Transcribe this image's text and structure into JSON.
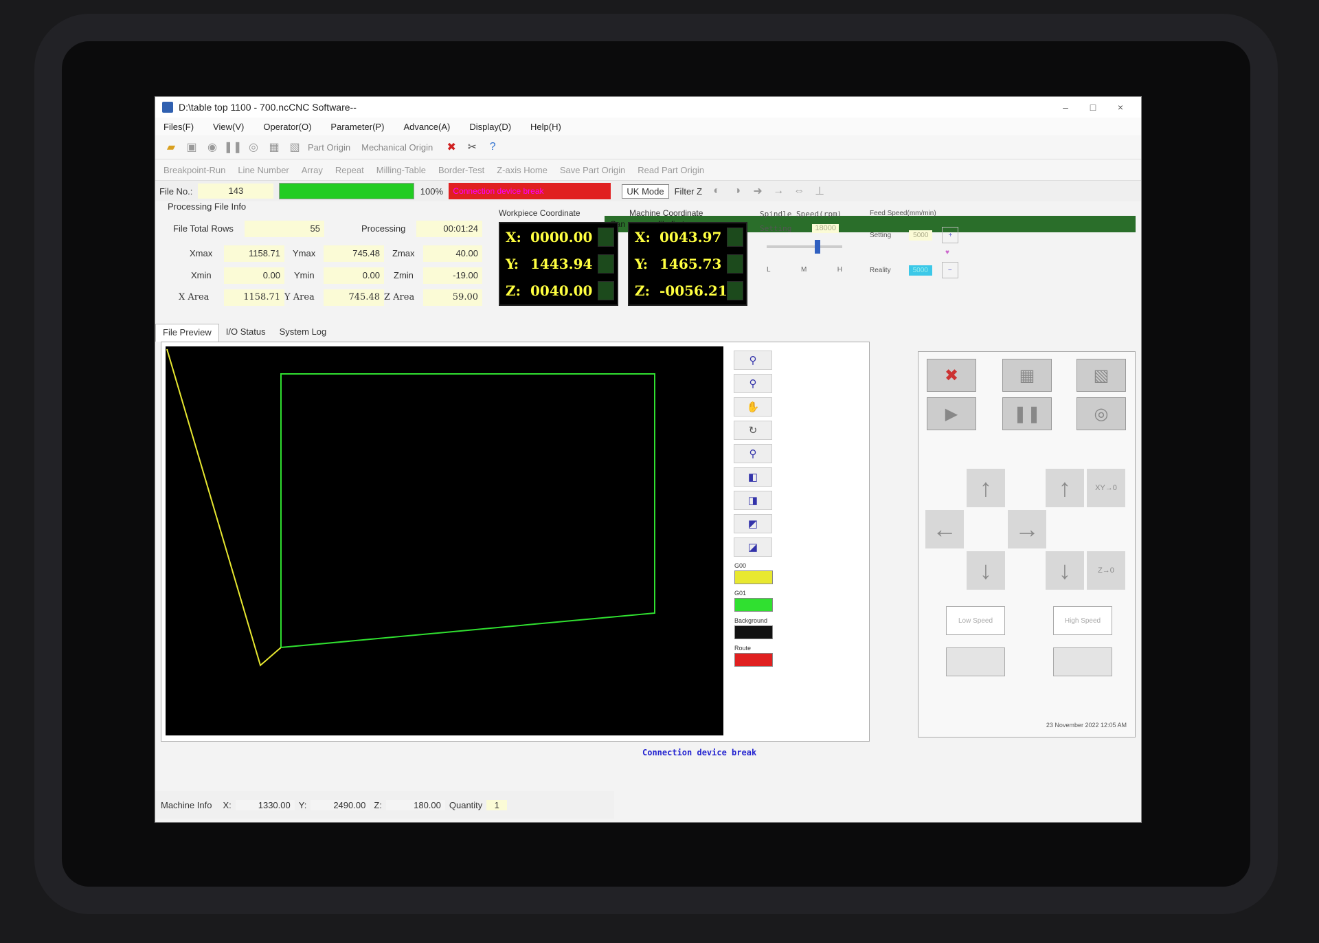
{
  "window": {
    "title": "D:\\table top 1100 - 700.ncCNC Software--",
    "controls": [
      "–",
      "□",
      "×"
    ]
  },
  "menu": [
    "Files(F)",
    "View(V)",
    "Operator(O)",
    "Parameter(P)",
    "Advance(A)",
    "Display(D)",
    "Help(H)"
  ],
  "toolbar": {
    "part_origin": "Part Origin",
    "mechanical_origin": "Mechanical Origin"
  },
  "toolbar2": [
    "Breakpoint-Run",
    "Line Number",
    "Array",
    "Repeat",
    "Milling-Table",
    "Border-Test",
    "Z-axis Home",
    "Save Part Origin",
    "Read Part Origin"
  ],
  "status": {
    "file_no_label": "File No.:",
    "file_no": "143",
    "progress": 100,
    "progress_text": "100%",
    "alert": "Connection device break",
    "uk_mode": "UK Mode",
    "filter_z": "Filter Z",
    "message": "Can prepare file first"
  },
  "processing": {
    "title": "Processing File Info",
    "total_rows_label": "File Total Rows",
    "total_rows": "55",
    "processing_label": "Processing",
    "processing_time": "00:01:24",
    "xmax_label": "Xmax",
    "xmax": "1158.71",
    "ymax_label": "Ymax",
    "ymax": "745.48",
    "zmax_label": "Zmax",
    "zmax": "40.00",
    "xmin_label": "Xmin",
    "xmin": "0.00",
    "ymin_label": "Ymin",
    "ymin": "0.00",
    "zmin_label": "Zmin",
    "zmin": "-19.00",
    "xarea_label": "X Area",
    "xarea": "1158.71",
    "yarea_label": "Y Area",
    "yarea": "745.48",
    "zarea_label": "Z Area",
    "zarea": "59.00"
  },
  "workpiece": {
    "title": "Workpiece Coordinate",
    "x_label": "X:",
    "x": "0000.00",
    "y_label": "Y:",
    "y": "1443.94",
    "z_label": "Z:",
    "z": "0040.00"
  },
  "machine": {
    "title": "Machine Coordinate",
    "x_label": "X:",
    "x": "0043.97",
    "y_label": "Y:",
    "y": "1465.73",
    "z_label": "Z:",
    "z": "-0056.21"
  },
  "spindle": {
    "title": "Spindle Speed(rpm)",
    "setting_label": "Setting",
    "setting": "18000",
    "l": "L",
    "m": "M",
    "h": "H"
  },
  "feed": {
    "title": "Feed Speed(mm/min)",
    "setting_label": "Setting",
    "setting": "5000",
    "reality_label": "Reality",
    "reality": "5000"
  },
  "tabs": [
    "File Preview",
    "I/O Status",
    "System Log"
  ],
  "legend": {
    "g00": "G00",
    "g01": "G01",
    "background": "Background",
    "route": "Route",
    "g00_color": "#e8e830",
    "g01_color": "#30e030",
    "background_color": "#111111",
    "route_color": "#e02020"
  },
  "connection_msg": "Connection device break",
  "controls": {
    "low_speed": "Low Speed",
    "high_speed": "High Speed",
    "x_y_zero": "XY→0",
    "z_zero": "Z→0"
  },
  "machine_info": {
    "label": "Machine Info",
    "x_label": "X:",
    "x": "1330.00",
    "y_label": "Y:",
    "y": "2490.00",
    "z_label": "Z:",
    "z": "180.00",
    "qty_label": "Quantity",
    "qty": "1"
  },
  "datetime": "23 November 2022 12:05 AM"
}
